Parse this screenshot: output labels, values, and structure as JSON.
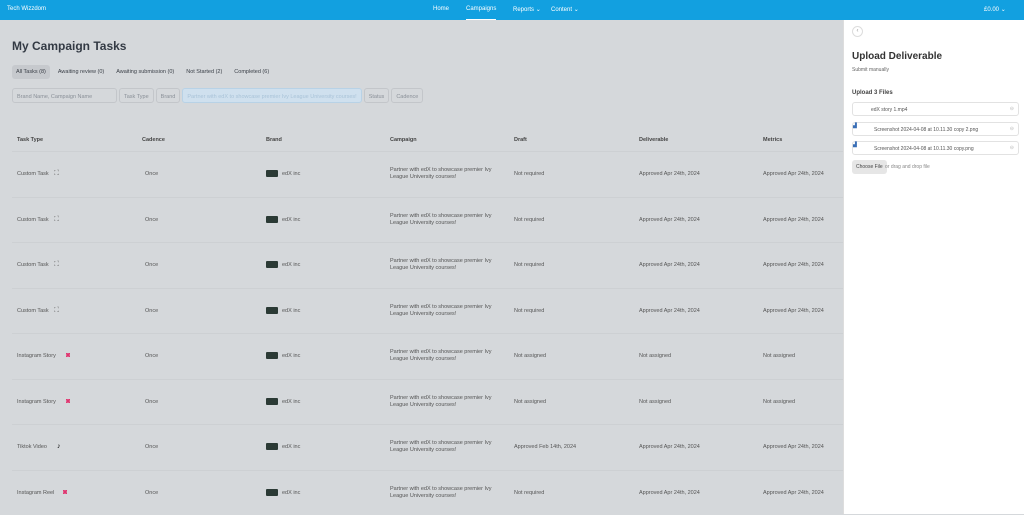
{
  "nav": {
    "brand": "Tech Wizzdom",
    "items": [
      "Home",
      "Campaigns",
      "Reports",
      "Content"
    ],
    "balance": "£0.00"
  },
  "page_title": "My Campaign Tasks",
  "tabs": [
    "All Tasks (8)",
    "Awaiting review (0)",
    "Awaiting submission (0)",
    "Not Started (2)",
    "Completed (6)"
  ],
  "filters": {
    "search_placeholder": "Brand Name, Campaign Name",
    "task_type": "Task Type",
    "brand": "Brand",
    "campaign": "Partner with edX to showcase premier Ivy League University courses!",
    "status": "Status",
    "cadence": "Cadence"
  },
  "columns": [
    "Task Type",
    "Cadence",
    "Brand",
    "Campaign",
    "Draft",
    "Deliverable",
    "Metrics"
  ],
  "rows": [
    {
      "type": "Custom Task",
      "icon": "custom",
      "cadence": "Once",
      "brand": "edX inc",
      "campaign": "Partner with edX to showcase premier Ivy League University courses!",
      "draft": "Not required",
      "deliverable": "Approved Apr 24th, 2024",
      "metrics": "Approved Apr 24th, 2024"
    },
    {
      "type": "Custom Task",
      "icon": "custom",
      "cadence": "Once",
      "brand": "edX inc",
      "campaign": "Partner with edX to showcase premier Ivy League University courses!",
      "draft": "Not required",
      "deliverable": "Approved Apr 24th, 2024",
      "metrics": "Approved Apr 24th, 2024"
    },
    {
      "type": "Custom Task",
      "icon": "custom",
      "cadence": "Once",
      "brand": "edX inc",
      "campaign": "Partner with edX to showcase premier Ivy League University courses!",
      "draft": "Not required",
      "deliverable": "Approved Apr 24th, 2024",
      "metrics": "Approved Apr 24th, 2024"
    },
    {
      "type": "Custom Task",
      "icon": "custom",
      "cadence": "Once",
      "brand": "edX inc",
      "campaign": "Partner with edX to showcase premier Ivy League University courses!",
      "draft": "Not required",
      "deliverable": "Approved Apr 24th, 2024",
      "metrics": "Approved Apr 24th, 2024"
    },
    {
      "type": "Instagram Story",
      "icon": "instagram",
      "cadence": "Once",
      "brand": "edX inc",
      "campaign": "Partner with edX to showcase premier Ivy League University courses!",
      "draft": "Not assigned",
      "deliverable": "Not assigned",
      "metrics": "Not assigned"
    },
    {
      "type": "Instagram Story",
      "icon": "instagram",
      "cadence": "Once",
      "brand": "edX inc",
      "campaign": "Partner with edX to showcase premier Ivy League University courses!",
      "draft": "Not assigned",
      "deliverable": "Not assigned",
      "metrics": "Not assigned"
    },
    {
      "type": "Tiktok Video",
      "icon": "tiktok",
      "cadence": "Once",
      "brand": "edX inc",
      "campaign": "Partner with edX to showcase premier Ivy League University courses!",
      "draft": "Approved Feb 14th, 2024",
      "deliverable": "Approved Apr 24th, 2024",
      "metrics": "Approved Apr 24th, 2024"
    },
    {
      "type": "Instagram Reel",
      "icon": "instagram",
      "cadence": "Once",
      "brand": "edX inc",
      "campaign": "Partner with edX to showcase premier Ivy League University courses!",
      "draft": "Not required",
      "deliverable": "Approved Apr 24th, 2024",
      "metrics": "Approved Apr 24th, 2024"
    }
  ],
  "panel": {
    "title": "Upload Deliverable",
    "subtitle": "Submit manually",
    "files_heading": "Upload 3 Files",
    "files": [
      "edX story 1.mp4",
      "Screenshot 2024-04-08 at 10.11.30 copy 2.png",
      "Screenshot 2024-04-08 at 10.11.30 copy.png"
    ],
    "choose_file": "Choose File",
    "drop_hint": "or drag and drop file"
  }
}
